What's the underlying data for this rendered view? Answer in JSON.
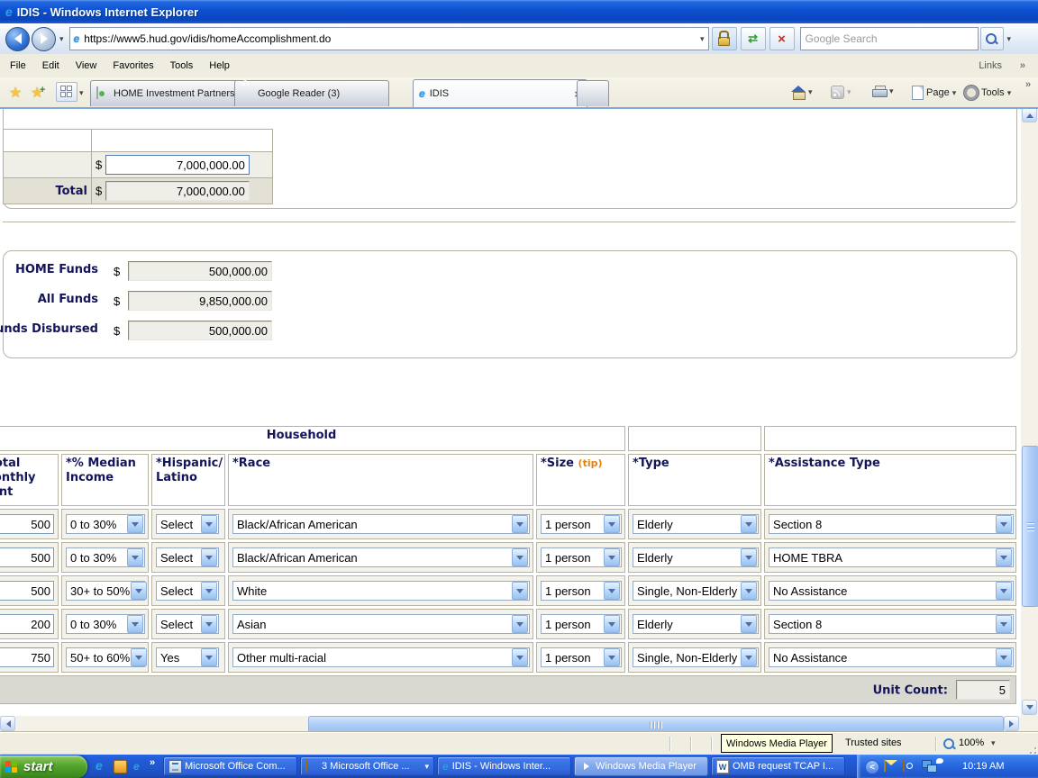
{
  "window": {
    "title": "IDIS - Windows Internet Explorer"
  },
  "browser": {
    "url": "https://www5.hud.gov/idis/homeAccomplishment.do",
    "search_placeholder": "Google Search",
    "menu_items": [
      "File",
      "Edit",
      "View",
      "Favorites",
      "Tools",
      "Help"
    ],
    "links_label": "Links",
    "tabs": [
      {
        "label": "HOME Investment Partnershi..."
      },
      {
        "label": "Google Reader (3)"
      },
      {
        "label": "IDIS"
      }
    ],
    "page_label": "Page",
    "tools_label": "Tools"
  },
  "icons": {
    "ie_logo": "e",
    "star": "★",
    "chevron": "»",
    "dropdown": "▾",
    "close": "×",
    "refresh": "⇄",
    "plus": "+",
    "word": "W",
    "three": "3"
  },
  "form_top": {
    "currency": "$",
    "amount_value": "7,000,000.00",
    "total_label": "Total",
    "total_value": "7,000,000.00"
  },
  "funds": {
    "currency": "$",
    "rows": [
      {
        "label": "HOME Funds",
        "value": "500,000.00"
      },
      {
        "label": "All Funds",
        "value": "9,850,000.00"
      },
      {
        "label": "Funds Disbursed",
        "value": "500,000.00"
      }
    ]
  },
  "household": {
    "group_header": "Household",
    "col_rent": "*Total Monthly Rent",
    "col_income": "*% Median Income",
    "col_hispanic": "*Hispanic/ Latino",
    "col_race": "*Race",
    "col_size": "*Size",
    "col_size_tip": "(tip)",
    "col_type": "*Type",
    "col_assistance": "*Assistance Type",
    "rows": [
      {
        "rent": "500",
        "income": "0 to 30%",
        "hispanic": "Select",
        "race": "Black/African American",
        "size": "1 person",
        "type": "Elderly",
        "assistance": "Section 8"
      },
      {
        "rent": "500",
        "income": "0 to 30%",
        "hispanic": "Select",
        "race": "Black/African American",
        "size": "1 person",
        "type": "Elderly",
        "assistance": "HOME TBRA"
      },
      {
        "rent": "500",
        "income": "30+ to 50%",
        "hispanic": "Select",
        "race": "White",
        "size": "1 person",
        "type": "Single, Non-Elderly",
        "assistance": "No Assistance"
      },
      {
        "rent": "200",
        "income": "0 to 30%",
        "hispanic": "Select",
        "race": "Asian",
        "size": "1 person",
        "type": "Elderly",
        "assistance": "Section 8"
      },
      {
        "rent": "750",
        "income": "50+ to 60%",
        "hispanic": "Yes",
        "race": "Other multi-racial",
        "size": "1 person",
        "type": "Single, Non-Elderly",
        "assistance": "No Assistance"
      }
    ],
    "unit_count_label": "Unit Count:",
    "unit_count_value": "5"
  },
  "status": {
    "tooltip": "Windows Media Player",
    "zone": "Trusted sites",
    "zoom_level": "100%"
  },
  "taskbar": {
    "start_label": "start",
    "buttons": [
      {
        "label": "Microsoft Office Com..."
      },
      {
        "label": "3 Microsoft Office ..."
      },
      {
        "label": "IDIS - Windows Inter..."
      },
      {
        "label": "Windows Media Player"
      },
      {
        "label": "OMB request TCAP I..."
      }
    ],
    "clock": "10:19 AM"
  }
}
